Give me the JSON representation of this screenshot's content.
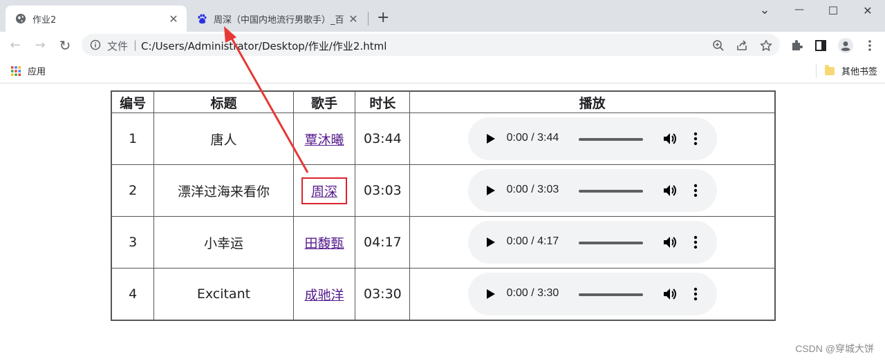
{
  "browser": {
    "tabs": [
      {
        "title": "作业2",
        "close": "✕"
      },
      {
        "title": "周深（中国内地流行男歌手）_百",
        "close": "✕"
      }
    ],
    "new_tab": "+",
    "window": {
      "dropdown": "⌄",
      "minimize": "—",
      "maximize": "☐",
      "close": "✕"
    }
  },
  "toolbar": {
    "back": "←",
    "forward": "→",
    "reload": "↻",
    "scheme_label": "文件",
    "separator": "|",
    "url": "C:/Users/Administrator/Desktop/作业/作业2.html"
  },
  "bookmarks": {
    "apps_label": "应用",
    "other_label": "其他书签"
  },
  "table": {
    "headers": [
      "编号",
      "标题",
      "歌手",
      "时长",
      "播放"
    ],
    "rows": [
      {
        "num": "1",
        "title": "唐人",
        "singer": "覃沐曦",
        "duration": "03:44",
        "player_time": "0:00 / 3:44"
      },
      {
        "num": "2",
        "title": "漂洋过海来看你",
        "singer": "周深",
        "duration": "03:03",
        "player_time": "0:00 / 3:03"
      },
      {
        "num": "3",
        "title": "小幸运",
        "singer": "田馥甄",
        "duration": "04:17",
        "player_time": "0:00 / 4:17"
      },
      {
        "num": "4",
        "title": "Excitant",
        "singer": "成驰洋",
        "duration": "03:30",
        "player_time": "0:00 / 3:30"
      }
    ]
  },
  "watermark": "CSDN @穿城大饼",
  "colors": {
    "annotation": "#d9232d",
    "link_visited": "#551a8b"
  }
}
